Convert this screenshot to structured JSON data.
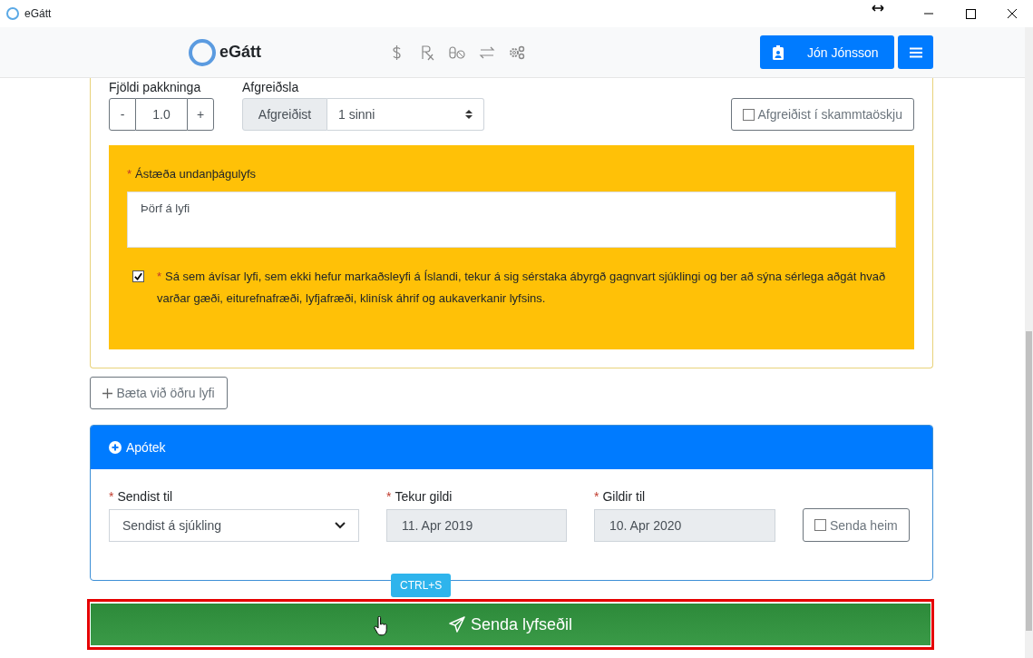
{
  "window": {
    "title": "eGátt"
  },
  "navbar": {
    "brand": "eGátt",
    "user": "Jón Jónsson"
  },
  "quantity": {
    "label": "Fjöldi pakkninga",
    "minus": "-",
    "value": "1.0",
    "plus": "+"
  },
  "dispense": {
    "label": "Afgreiðsla",
    "addon": "Afgreiðist",
    "value": "1 sinni"
  },
  "dose_box": {
    "label": "Afgreiðist í skammtaöskju",
    "checked": false
  },
  "exemption": {
    "required_mark": "*",
    "label": "Ástæða undanþágulyfs",
    "value": "Þörf á lyfi",
    "consent_checked": true,
    "consent_text": "Sá sem ávísar lyfi, sem ekki hefur markaðsleyfi á Íslandi, tekur á sig sérstaka ábyrgð gagnvart sjúklingi og ber að sýna sérlega aðgát hvað varðar gæði, eiturefnafræði, lyfjafræði, klinísk áhrif og aukaverkanir lyfsins."
  },
  "add_button": "Bæta við öðru lyfi",
  "pharmacy": {
    "title": "Apótek",
    "fields": [
      {
        "kind": "select",
        "required_mark": "*",
        "label": "Sendist til",
        "value": "Sendist á sjúkling"
      },
      {
        "kind": "readonly",
        "required_mark": "*",
        "label": "Tekur gildi",
        "value": "11. Apr 2019"
      },
      {
        "kind": "readonly",
        "required_mark": "*",
        "label": "Gildir til",
        "value": "10. Apr 2020"
      }
    ],
    "home": {
      "label": "Senda heim",
      "checked": false
    }
  },
  "shortcut": "CTRL+S",
  "submit": "Senda lyfseðil"
}
